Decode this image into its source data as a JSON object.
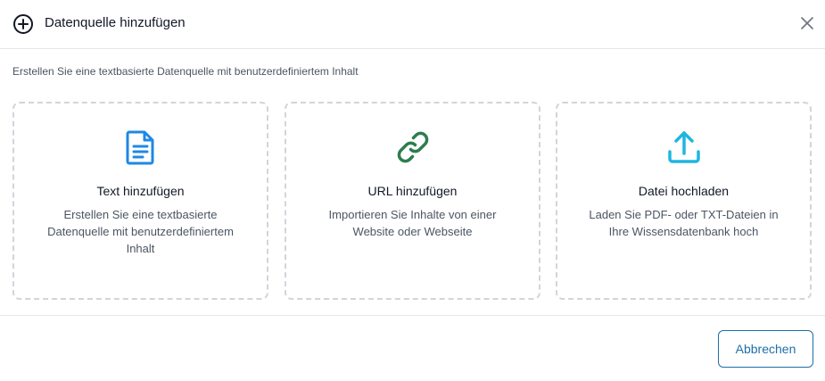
{
  "dialog": {
    "title": "Datenquelle hinzufügen",
    "description": "Erstellen Sie eine textbasierte Datenquelle mit benutzerdefiniertem Inhalt"
  },
  "options": [
    {
      "icon": "document-icon",
      "title": "Text hinzufügen",
      "description": "Erstellen Sie eine textbasierte Datenquelle mit benutzerdefiniertem Inhalt",
      "icon_color": "#1e88e5"
    },
    {
      "icon": "link-icon",
      "title": "URL hinzufügen",
      "description": "Importieren Sie Inhalte von einer Website oder Webseite",
      "icon_color": "#2e7d4f"
    },
    {
      "icon": "upload-icon",
      "title": "Datei hochladen",
      "description": "Laden Sie PDF- oder TXT-Dateien in Ihre Wissensdatenbank hoch",
      "icon_color": "#1fb6e0"
    }
  ],
  "footer": {
    "cancel_label": "Abbrechen"
  }
}
